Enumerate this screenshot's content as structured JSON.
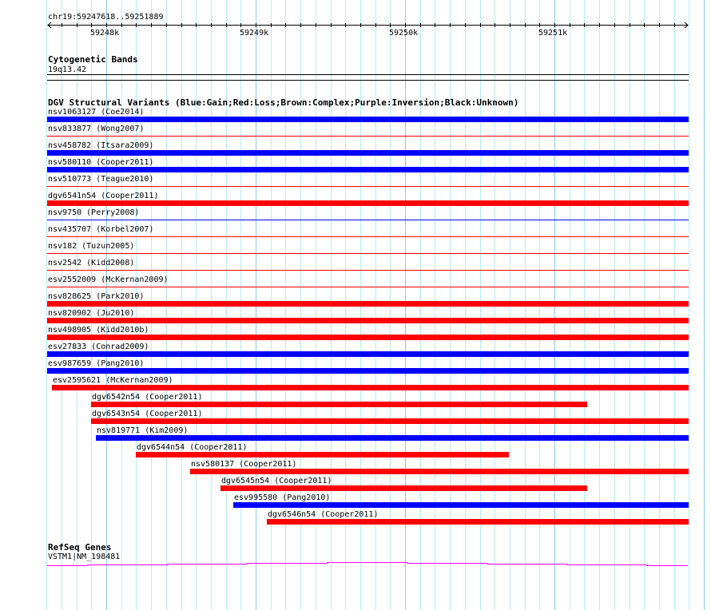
{
  "ruler": {
    "region_label": "chr19:59247618..59251889",
    "view_start": 59247618,
    "view_end": 59251889,
    "ticks": [
      {
        "bp": 59248000,
        "label": "59248k"
      },
      {
        "bp": 59249000,
        "label": "59249k"
      },
      {
        "bp": 59250000,
        "label": "59250k"
      },
      {
        "bp": 59251000,
        "label": "59251k"
      }
    ]
  },
  "cytoband": {
    "title": "Cytogenetic Bands",
    "band": "19q13.42"
  },
  "dgv": {
    "title": "DGV Structural Variants (Blue:Gain;Red:Loss;Brown:Complex;Purple:Inversion;Black:Unknown)",
    "colors": {
      "gain": "#0000ff",
      "loss": "#ff0000"
    },
    "variants": [
      {
        "label": "nsv1063127 (Coe2014)",
        "type": "gain",
        "style": "bar",
        "start": 59247618,
        "end": 59251889
      },
      {
        "label": "nsv833877 (Wong2007)",
        "type": "loss",
        "style": "line",
        "start": 59247618,
        "end": 59251889
      },
      {
        "label": "nsv458782 (Itsara2009)",
        "type": "gain",
        "style": "bar",
        "start": 59247618,
        "end": 59251889
      },
      {
        "label": "nsv580110 (Cooper2011)",
        "type": "gain",
        "style": "bar",
        "start": 59247618,
        "end": 59251889
      },
      {
        "label": "nsv510773 (Teague2010)",
        "type": "loss",
        "style": "line",
        "start": 59247618,
        "end": 59251889
      },
      {
        "label": "dgv6541n54 (Cooper2011)",
        "type": "loss",
        "style": "bar",
        "start": 59247618,
        "end": 59251889
      },
      {
        "label": "nsv9750 (Perry2008)",
        "type": "gain",
        "style": "line",
        "start": 59247618,
        "end": 59251889
      },
      {
        "label": "nsv435707 (Korbel2007)",
        "type": "loss",
        "style": "line",
        "start": 59247618,
        "end": 59251889
      },
      {
        "label": "nsv182 (Tuzun2005)",
        "type": "loss",
        "style": "line",
        "start": 59247618,
        "end": 59251889
      },
      {
        "label": "nsv2542 (Kidd2008)",
        "type": "loss",
        "style": "line",
        "start": 59247618,
        "end": 59251889
      },
      {
        "label": "esv2552009 (McKernan2009)",
        "type": "loss",
        "style": "line",
        "start": 59247618,
        "end": 59251889
      },
      {
        "label": "nsv828625 (Park2010)",
        "type": "loss",
        "style": "bar",
        "start": 59247618,
        "end": 59251889
      },
      {
        "label": "nsv820902 (Ju2010)",
        "type": "loss",
        "style": "bar",
        "start": 59247618,
        "end": 59251889
      },
      {
        "label": "nsv498905 (Kidd2010b)",
        "type": "loss",
        "style": "bar",
        "start": 59247618,
        "end": 59251889
      },
      {
        "label": "esv27833 (Conrad2009)",
        "type": "gain",
        "style": "bar",
        "start": 59247618,
        "end": 59251889
      },
      {
        "label": "esv987659 (Pang2010)",
        "type": "gain",
        "style": "bar",
        "start": 59247618,
        "end": 59251889
      },
      {
        "label": "esv2595621 (McKernan2009)",
        "type": "loss",
        "style": "bar",
        "start": 59247636,
        "end": 59251889
      },
      {
        "label": "dgv6542n54 (Cooper2011)",
        "type": "loss",
        "style": "bar",
        "start": 59247898,
        "end": 59251219
      },
      {
        "label": "dgv6543n54 (Cooper2011)",
        "type": "loss",
        "style": "bar",
        "start": 59247898,
        "end": 59251889
      },
      {
        "label": "nsv819771 (Kim2009)",
        "type": "gain",
        "style": "bar",
        "start": 59247930,
        "end": 59251889
      },
      {
        "label": "dgv6544n54 (Cooper2011)",
        "type": "loss",
        "style": "bar",
        "start": 59248198,
        "end": 59250695
      },
      {
        "label": "nsv580137 (Cooper2011)",
        "type": "loss",
        "style": "bar",
        "start": 59248561,
        "end": 59251889
      },
      {
        "label": "dgv6545n54 (Cooper2011)",
        "type": "loss",
        "style": "bar",
        "start": 59248765,
        "end": 59251219
      },
      {
        "label": "esv995580 (Pang2010)",
        "type": "gain",
        "style": "bar",
        "start": 59248850,
        "end": 59251889
      },
      {
        "label": "dgv6546n54 (Cooper2011)",
        "type": "loss",
        "style": "bar",
        "start": 59249075,
        "end": 59251889
      }
    ]
  },
  "refseq": {
    "title": "RefSeq Genes",
    "gene_label": "VSTM1|NM_198481",
    "color": "#ff00ff"
  }
}
